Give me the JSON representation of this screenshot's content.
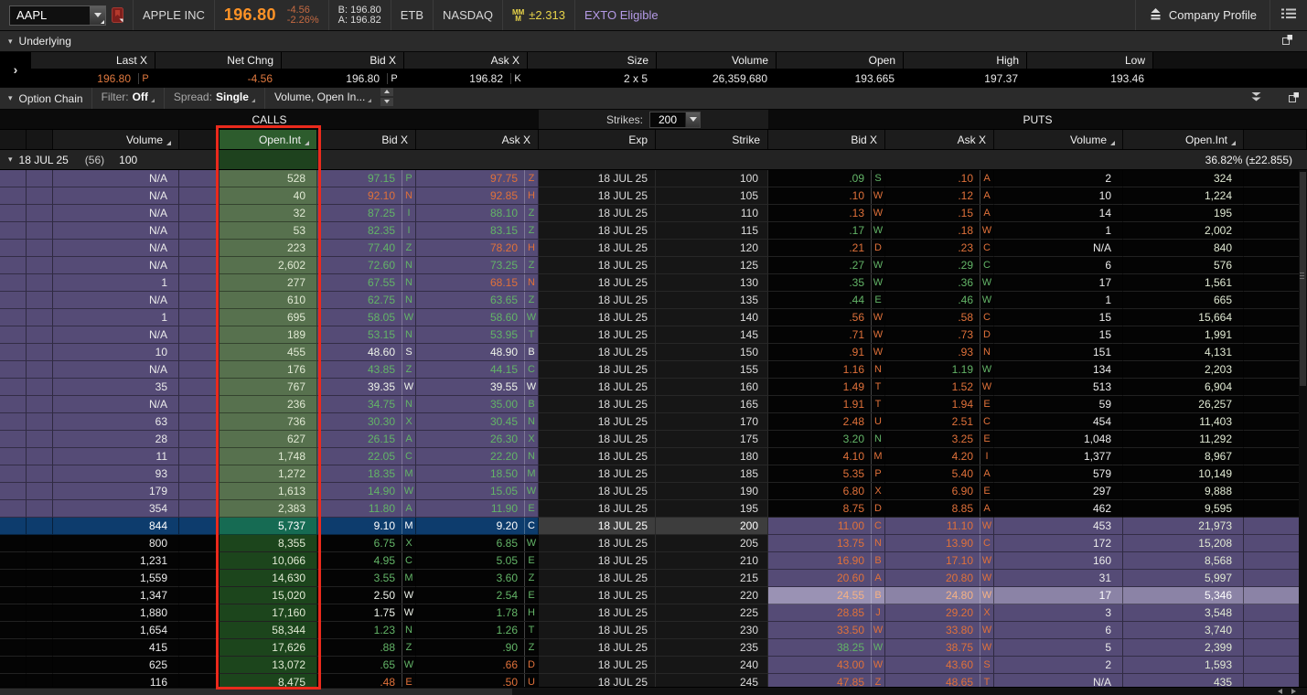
{
  "top_bar": {
    "symbol": "AAPL",
    "company": "APPLE INC",
    "last": "196.80",
    "chg": "-4.56",
    "chg_pct": "-2.26%",
    "bid_label": "B: 196.80",
    "ask_label": "A: 196.82",
    "etb": "ETB",
    "exchange": "NASDAQ",
    "mm_value": "±2.313",
    "exto": "EXTO Eligible",
    "company_profile": "Company Profile"
  },
  "underlying": {
    "title": "Underlying",
    "columns": [
      {
        "label": "Last X",
        "value": "196.80",
        "x": "P",
        "c": "o"
      },
      {
        "label": "Net Chng",
        "value": "-4.56",
        "x": "",
        "c": "o"
      },
      {
        "label": "Bid X",
        "value": "196.80",
        "x": "P",
        "c": "w"
      },
      {
        "label": "Ask X",
        "value": "196.82",
        "x": "K",
        "c": "w"
      },
      {
        "label": "Size",
        "value": "2 x 5",
        "x": "",
        "c": "w"
      },
      {
        "label": "Volume",
        "value": "26,359,680",
        "x": "",
        "c": "w"
      },
      {
        "label": "Open",
        "value": "193.665",
        "x": "",
        "c": "w"
      },
      {
        "label": "High",
        "value": "197.37",
        "x": "",
        "c": "w"
      },
      {
        "label": "Low",
        "value": "193.46",
        "x": "",
        "c": "w"
      }
    ]
  },
  "option_chain": {
    "title": "Option Chain",
    "filter_label": "Filter:",
    "filter_value": "Off",
    "spread_label": "Spread:",
    "spread_value": "Single",
    "layout_value": "Volume, Open In...",
    "calls_label": "CALLS",
    "puts_label": "PUTS",
    "strikes_label": "Strikes:",
    "strikes_value": "200",
    "call_headers": [
      "Volume",
      "Open.Int",
      "Bid X",
      "Ask X"
    ],
    "mid_headers": [
      "Exp",
      "Strike"
    ],
    "put_headers": [
      "Bid X",
      "Ask X",
      "Volume",
      "Open.Int"
    ],
    "group": {
      "exp": "18 JUL 25",
      "dte": "(56)",
      "mult": "100",
      "iv": "36.82% (±22.855)"
    },
    "rows": [
      {
        "strike": "100",
        "c": {
          "vol": "N/A",
          "oi": "528",
          "bid": "97.15",
          "bx": "P",
          "bc": "g",
          "ask": "97.75",
          "ax": "Z",
          "ac": "o"
        },
        "p": {
          "bid": ".09",
          "bx": "S",
          "bc": "g",
          "ask": ".10",
          "ax": "A",
          "ac": "o",
          "vol": "2",
          "oi": "324"
        }
      },
      {
        "strike": "105",
        "c": {
          "vol": "N/A",
          "oi": "40",
          "bid": "92.10",
          "bx": "N",
          "bc": "o",
          "ask": "92.85",
          "ax": "H",
          "ac": "o"
        },
        "p": {
          "bid": ".10",
          "bx": "W",
          "bc": "o",
          "ask": ".12",
          "ax": "A",
          "ac": "o",
          "vol": "10",
          "oi": "1,224"
        }
      },
      {
        "strike": "110",
        "c": {
          "vol": "N/A",
          "oi": "32",
          "bid": "87.25",
          "bx": "I",
          "bc": "g",
          "ask": "88.10",
          "ax": "Z",
          "ac": "g"
        },
        "p": {
          "bid": ".13",
          "bx": "W",
          "bc": "o",
          "ask": ".15",
          "ax": "A",
          "ac": "o",
          "vol": "14",
          "oi": "195"
        }
      },
      {
        "strike": "115",
        "c": {
          "vol": "N/A",
          "oi": "53",
          "bid": "82.35",
          "bx": "I",
          "bc": "g",
          "ask": "83.15",
          "ax": "Z",
          "ac": "g"
        },
        "p": {
          "bid": ".17",
          "bx": "W",
          "bc": "g",
          "ask": ".18",
          "ax": "W",
          "ac": "o",
          "vol": "1",
          "oi": "2,002"
        }
      },
      {
        "strike": "120",
        "c": {
          "vol": "N/A",
          "oi": "223",
          "bid": "77.40",
          "bx": "Z",
          "bc": "g",
          "ask": "78.20",
          "ax": "H",
          "ac": "o"
        },
        "p": {
          "bid": ".21",
          "bx": "D",
          "bc": "o",
          "ask": ".23",
          "ax": "C",
          "ac": "o",
          "vol": "N/A",
          "oi": "840"
        }
      },
      {
        "strike": "125",
        "c": {
          "vol": "N/A",
          "oi": "2,602",
          "bid": "72.60",
          "bx": "N",
          "bc": "g",
          "ask": "73.25",
          "ax": "Z",
          "ac": "g"
        },
        "p": {
          "bid": ".27",
          "bx": "W",
          "bc": "g",
          "ask": ".29",
          "ax": "C",
          "ac": "g",
          "vol": "6",
          "oi": "576"
        }
      },
      {
        "strike": "130",
        "c": {
          "vol": "1",
          "oi": "277",
          "bid": "67.55",
          "bx": "N",
          "bc": "g",
          "ask": "68.15",
          "ax": "N",
          "ac": "o"
        },
        "p": {
          "bid": ".35",
          "bx": "W",
          "bc": "g",
          "ask": ".36",
          "ax": "W",
          "ac": "g",
          "vol": "17",
          "oi": "1,561"
        }
      },
      {
        "strike": "135",
        "c": {
          "vol": "N/A",
          "oi": "610",
          "bid": "62.75",
          "bx": "N",
          "bc": "g",
          "ask": "63.65",
          "ax": "Z",
          "ac": "g"
        },
        "p": {
          "bid": ".44",
          "bx": "E",
          "bc": "g",
          "ask": ".46",
          "ax": "W",
          "ac": "g",
          "vol": "1",
          "oi": "665"
        }
      },
      {
        "strike": "140",
        "c": {
          "vol": "1",
          "oi": "695",
          "bid": "58.05",
          "bx": "W",
          "bc": "g",
          "ask": "58.60",
          "ax": "W",
          "ac": "g"
        },
        "p": {
          "bid": ".56",
          "bx": "W",
          "bc": "o",
          "ask": ".58",
          "ax": "C",
          "ac": "o",
          "vol": "15",
          "oi": "15,664"
        }
      },
      {
        "strike": "145",
        "c": {
          "vol": "N/A",
          "oi": "189",
          "bid": "53.15",
          "bx": "N",
          "bc": "g",
          "ask": "53.95",
          "ax": "T",
          "ac": "g"
        },
        "p": {
          "bid": ".71",
          "bx": "W",
          "bc": "o",
          "ask": ".73",
          "ax": "D",
          "ac": "o",
          "vol": "15",
          "oi": "1,991"
        }
      },
      {
        "strike": "150",
        "c": {
          "vol": "10",
          "oi": "455",
          "bid": "48.60",
          "bx": "S",
          "bc": "w",
          "ask": "48.90",
          "ax": "B",
          "ac": "w"
        },
        "p": {
          "bid": ".91",
          "bx": "W",
          "bc": "o",
          "ask": ".93",
          "ax": "N",
          "ac": "o",
          "vol": "151",
          "oi": "4,131"
        }
      },
      {
        "strike": "155",
        "c": {
          "vol": "N/A",
          "oi": "176",
          "bid": "43.85",
          "bx": "Z",
          "bc": "g",
          "ask": "44.15",
          "ax": "C",
          "ac": "g"
        },
        "p": {
          "bid": "1.16",
          "bx": "N",
          "bc": "o",
          "ask": "1.19",
          "ax": "W",
          "ac": "g",
          "vol": "134",
          "oi": "2,203"
        }
      },
      {
        "strike": "160",
        "c": {
          "vol": "35",
          "oi": "767",
          "bid": "39.35",
          "bx": "W",
          "bc": "w",
          "ask": "39.55",
          "ax": "W",
          "ac": "w"
        },
        "p": {
          "bid": "1.49",
          "bx": "T",
          "bc": "o",
          "ask": "1.52",
          "ax": "W",
          "ac": "o",
          "vol": "513",
          "oi": "6,904"
        }
      },
      {
        "strike": "165",
        "c": {
          "vol": "N/A",
          "oi": "236",
          "bid": "34.75",
          "bx": "N",
          "bc": "g",
          "ask": "35.00",
          "ax": "B",
          "ac": "g"
        },
        "p": {
          "bid": "1.91",
          "bx": "T",
          "bc": "o",
          "ask": "1.94",
          "ax": "E",
          "ac": "o",
          "vol": "59",
          "oi": "26,257"
        }
      },
      {
        "strike": "170",
        "c": {
          "vol": "63",
          "oi": "736",
          "bid": "30.30",
          "bx": "X",
          "bc": "g",
          "ask": "30.45",
          "ax": "N",
          "ac": "g"
        },
        "p": {
          "bid": "2.48",
          "bx": "U",
          "bc": "o",
          "ask": "2.51",
          "ax": "C",
          "ac": "o",
          "vol": "454",
          "oi": "11,403"
        }
      },
      {
        "strike": "175",
        "c": {
          "vol": "28",
          "oi": "627",
          "bid": "26.15",
          "bx": "A",
          "bc": "g",
          "ask": "26.30",
          "ax": "X",
          "ac": "g"
        },
        "p": {
          "bid": "3.20",
          "bx": "N",
          "bc": "g",
          "ask": "3.25",
          "ax": "E",
          "ac": "o",
          "vol": "1,048",
          "oi": "11,292"
        }
      },
      {
        "strike": "180",
        "c": {
          "vol": "11",
          "oi": "1,748",
          "bid": "22.05",
          "bx": "C",
          "bc": "g",
          "ask": "22.20",
          "ax": "N",
          "ac": "g"
        },
        "p": {
          "bid": "4.10",
          "bx": "M",
          "bc": "o",
          "ask": "4.20",
          "ax": "I",
          "ac": "o",
          "vol": "1,377",
          "oi": "8,967"
        }
      },
      {
        "strike": "185",
        "c": {
          "vol": "93",
          "oi": "1,272",
          "bid": "18.35",
          "bx": "M",
          "bc": "g",
          "ask": "18.50",
          "ax": "M",
          "ac": "g"
        },
        "p": {
          "bid": "5.35",
          "bx": "P",
          "bc": "o",
          "ask": "5.40",
          "ax": "A",
          "ac": "o",
          "vol": "579",
          "oi": "10,149"
        }
      },
      {
        "strike": "190",
        "c": {
          "vol": "179",
          "oi": "1,613",
          "bid": "14.90",
          "bx": "W",
          "bc": "g",
          "ask": "15.05",
          "ax": "W",
          "ac": "g"
        },
        "p": {
          "bid": "6.80",
          "bx": "X",
          "bc": "o",
          "ask": "6.90",
          "ax": "E",
          "ac": "o",
          "vol": "297",
          "oi": "9,888"
        }
      },
      {
        "strike": "195",
        "c": {
          "vol": "354",
          "oi": "2,383",
          "bid": "11.80",
          "bx": "A",
          "bc": "g",
          "ask": "11.90",
          "ax": "E",
          "ac": "g"
        },
        "p": {
          "bid": "8.75",
          "bx": "D",
          "bc": "o",
          "ask": "8.85",
          "ax": "A",
          "ac": "o",
          "vol": "462",
          "oi": "9,595"
        }
      },
      {
        "strike": "200",
        "c": {
          "vol": "844",
          "oi": "5,737",
          "bid": "9.10",
          "bx": "M",
          "bc": "w",
          "ask": "9.20",
          "ax": "C",
          "ac": "w"
        },
        "p": {
          "bid": "11.00",
          "bx": "C",
          "bc": "o",
          "ask": "11.10",
          "ax": "W",
          "ac": "o",
          "vol": "453",
          "oi": "21,973"
        }
      },
      {
        "strike": "205",
        "c": {
          "vol": "800",
          "oi": "8,355",
          "bid": "6.75",
          "bx": "X",
          "bc": "g",
          "ask": "6.85",
          "ax": "W",
          "ac": "g"
        },
        "p": {
          "bid": "13.75",
          "bx": "N",
          "bc": "o",
          "ask": "13.90",
          "ax": "C",
          "ac": "o",
          "vol": "172",
          "oi": "15,208"
        }
      },
      {
        "strike": "210",
        "c": {
          "vol": "1,231",
          "oi": "10,066",
          "bid": "4.95",
          "bx": "C",
          "bc": "g",
          "ask": "5.05",
          "ax": "E",
          "ac": "g"
        },
        "p": {
          "bid": "16.90",
          "bx": "B",
          "bc": "o",
          "ask": "17.10",
          "ax": "W",
          "ac": "o",
          "vol": "160",
          "oi": "8,568"
        }
      },
      {
        "strike": "215",
        "c": {
          "vol": "1,559",
          "oi": "14,630",
          "bid": "3.55",
          "bx": "M",
          "bc": "g",
          "ask": "3.60",
          "ax": "Z",
          "ac": "g"
        },
        "p": {
          "bid": "20.60",
          "bx": "A",
          "bc": "o",
          "ask": "20.80",
          "ax": "W",
          "ac": "o",
          "vol": "31",
          "oi": "5,997"
        }
      },
      {
        "strike": "220",
        "sel": true,
        "c": {
          "vol": "1,347",
          "oi": "15,020",
          "bid": "2.50",
          "bx": "W",
          "bc": "w",
          "ask": "2.54",
          "ax": "E",
          "ac": "g"
        },
        "p": {
          "bid": "24.55",
          "bx": "B",
          "bc": "o",
          "ask": "24.80",
          "ax": "W",
          "ac": "o",
          "vol": "17",
          "oi": "5,346"
        }
      },
      {
        "strike": "225",
        "c": {
          "vol": "1,880",
          "oi": "17,160",
          "bid": "1.75",
          "bx": "W",
          "bc": "w",
          "ask": "1.78",
          "ax": "H",
          "ac": "g"
        },
        "p": {
          "bid": "28.85",
          "bx": "J",
          "bc": "o",
          "ask": "29.20",
          "ax": "X",
          "ac": "o",
          "vol": "3",
          "oi": "3,548"
        }
      },
      {
        "strike": "230",
        "c": {
          "vol": "1,654",
          "oi": "58,344",
          "bid": "1.23",
          "bx": "N",
          "bc": "g",
          "ask": "1.26",
          "ax": "T",
          "ac": "g"
        },
        "p": {
          "bid": "33.50",
          "bx": "W",
          "bc": "o",
          "ask": "33.80",
          "ax": "W",
          "ac": "o",
          "vol": "6",
          "oi": "3,740"
        }
      },
      {
        "strike": "235",
        "c": {
          "vol": "415",
          "oi": "17,626",
          "bid": ".88",
          "bx": "Z",
          "bc": "g",
          "ask": ".90",
          "ax": "Z",
          "ac": "g"
        },
        "p": {
          "bid": "38.25",
          "bx": "W",
          "bc": "g",
          "ask": "38.75",
          "ax": "W",
          "ac": "o",
          "vol": "5",
          "oi": "2,399"
        }
      },
      {
        "strike": "240",
        "c": {
          "vol": "625",
          "oi": "13,072",
          "bid": ".65",
          "bx": "W",
          "bc": "g",
          "ask": ".66",
          "ax": "D",
          "ac": "o"
        },
        "p": {
          "bid": "43.00",
          "bx": "W",
          "bc": "o",
          "ask": "43.60",
          "ax": "S",
          "ac": "o",
          "vol": "2",
          "oi": "1,593"
        }
      },
      {
        "strike": "245",
        "c": {
          "vol": "116",
          "oi": "8,475",
          "bid": ".48",
          "bx": "E",
          "bc": "o",
          "ask": ".50",
          "ax": "U",
          "ac": "o"
        },
        "p": {
          "bid": "47.85",
          "bx": "Z",
          "bc": "o",
          "ask": "48.65",
          "ax": "T",
          "ac": "o",
          "vol": "N/A",
          "oi": "435"
        }
      }
    ]
  },
  "colors": {
    "price_orange": "#ff9326",
    "change_red": "#c56a42",
    "quote_green": "#63b467",
    "quote_orange": "#e0713a",
    "itm_purple": "#554b76",
    "atm_blue": "#0d3c6d",
    "oi_green_itm": "#57714e",
    "oi_green_otm": "#1c451c",
    "oi_green_atm": "#166b53",
    "oi_header_green": "#2d5c2d",
    "highlight_red_box": "#ea2a1c",
    "mm_yellow": "#e8d44a",
    "exto_purple": "#b49ae6",
    "selected_put_row": "#8b83a6"
  }
}
